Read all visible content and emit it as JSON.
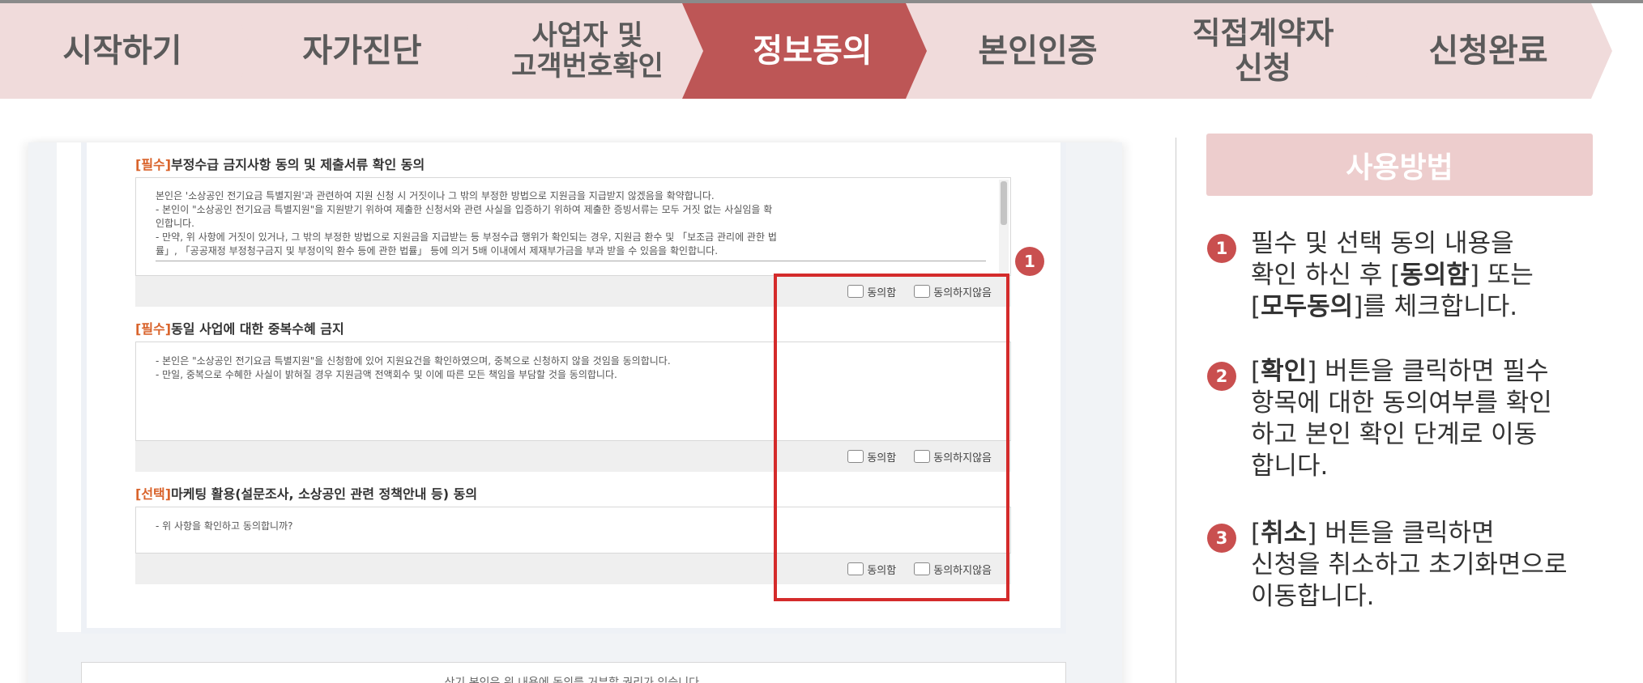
{
  "steps": [
    {
      "label": "시작하기",
      "active": false
    },
    {
      "label": "자가진단",
      "active": false
    },
    {
      "label": "사업자 및\n고객번호확인",
      "active": false
    },
    {
      "label": "정보동의",
      "active": true
    },
    {
      "label": "본인인증",
      "active": false
    },
    {
      "label": "직접계약자\n신청",
      "active": false
    },
    {
      "label": "신청완료",
      "active": false
    }
  ],
  "colors": {
    "step_inactive": "#f0dbdb",
    "step_active": "#bd5656",
    "highlight": "#d42b2b",
    "badge": "#c94f4f",
    "tag": "#d9632b"
  },
  "form": {
    "sections": [
      {
        "tag": "[필수]",
        "title": "부정수급 금지사항 동의 및 제출서류 확인 동의",
        "lines": [
          "본인은 '소상공인 전기요금 특별지원'과 관련하여 지원 신청 시 거짓이나 그 밖의 부정한 방법으로 지원금을 지급받지 않겠음을 확약합니다.",
          "- 본인이 \"소상공인 전기요금 특별지원\"을 지원받기 위하여 제출한 신청서와 관련 사실을 입증하기 위하여 제출한 증빙서류는 모두 거짓 없는 사실임을 확",
          "인합니다.",
          "- 만약, 위 사항에 거짓이 있거나, 그 밖의 부정한 방법으로 지원금을 지급받는 등 부정수급 행위가 확인되는 경우, 지원금 환수 및 「보조금 관리에 관한 법",
          "률」, 「공공재정 부정청구금지 및 부정이익 환수 등에 관한 법률」 등에 의거 5배 이내에서 제재부가금을 부과 받을 수 있음을 확인합니다."
        ],
        "agree_label": "동의함",
        "disagree_label": "동의하지않음"
      },
      {
        "tag": "[필수]",
        "title": "동일 사업에 대한 중복수혜 금지",
        "lines": [
          "- 본인은 \"소상공인 전기요금 특별지원\"을 신청함에 있어 지원요건을 확인하였으며, 중복으로 신청하지 않을 것임을 동의합니다.",
          "- 만일, 중복으로 수혜한 사실이 밝혀질 경우 지원금액 전액회수 및 이에 따른 모든 책임을 부담할 것을 동의합니다."
        ],
        "agree_label": "동의함",
        "disagree_label": "동의하지않음"
      },
      {
        "tag": "[선택]",
        "title": "마케팅 활용(설문조사, 소상공인 관련 정책안내 등) 동의",
        "lines": [
          "- 위 사항을 확인하고 동의합니까?"
        ],
        "agree_label": "동의함",
        "disagree_label": "동의하지않음"
      }
    ],
    "bottom_notice": "상기 본인은 위 내용에 동의를 거부할 권리가 있습니다.",
    "callout_badge": "1"
  },
  "help": {
    "title": "사용방법",
    "items": [
      {
        "num": "1",
        "pre": "필수 및 선택 동의 내용을\n확인 하신 후 [",
        "b1": "동의함",
        "mid": "] 또는\n[",
        "b2": "모두동의",
        "post": "]를 체크합니다."
      },
      {
        "num": "2",
        "pre": "[",
        "b1": "확인",
        "mid": "] 버튼을 클릭하면 필수\n항목에 대한 동의여부를 확인\n하고 본인 확인 단계로 이동\n합니다.",
        "b2": "",
        "post": ""
      },
      {
        "num": "3",
        "pre": "[",
        "b1": "취소",
        "mid": "] 버튼을 클릭하면\n신청을 취소하고 초기화면으로\n이동합니다.",
        "b2": "",
        "post": ""
      }
    ]
  }
}
